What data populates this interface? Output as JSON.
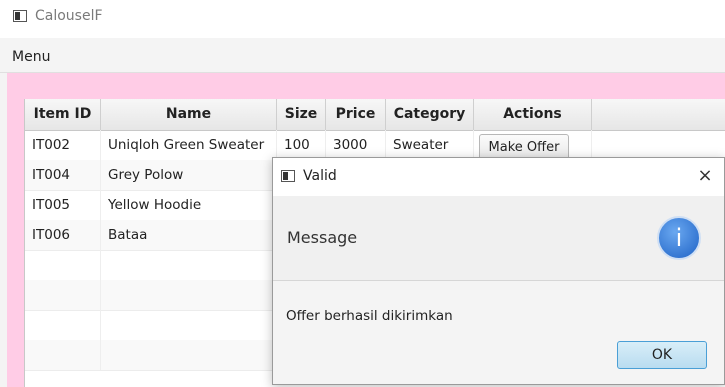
{
  "window": {
    "title": "CalouselF"
  },
  "menubar": {
    "menu_label": "Menu"
  },
  "table": {
    "columns": [
      "Item ID",
      "Name",
      "Size",
      "Price",
      "Category",
      "Actions"
    ],
    "rows": [
      {
        "id": "IT002",
        "name": "Uniqloh Green Sweater",
        "size": "100",
        "price": "3000",
        "category": "Sweater",
        "action": "Make Offer"
      },
      {
        "id": "IT004",
        "name": "Grey Polow",
        "size": "",
        "price": "",
        "category": "",
        "action": ""
      },
      {
        "id": "IT005",
        "name": "Yellow Hoodie",
        "size": "",
        "price": "",
        "category": "",
        "action": ""
      },
      {
        "id": "IT006",
        "name": "Bataa",
        "size": "",
        "price": "",
        "category": "",
        "action": ""
      }
    ]
  },
  "dialog": {
    "title": "Valid",
    "header": "Message",
    "message": "Offer berhasil dikirimkan",
    "ok_label": "OK",
    "close_symbol": "×",
    "info_symbol": "i"
  },
  "colors": {
    "background_pink": "#ffcce6",
    "ok_button": "#b9dcf0",
    "info_icon": "#1e62c6"
  },
  "icons": [
    "app-window-icon",
    "close-icon",
    "info-icon"
  ]
}
